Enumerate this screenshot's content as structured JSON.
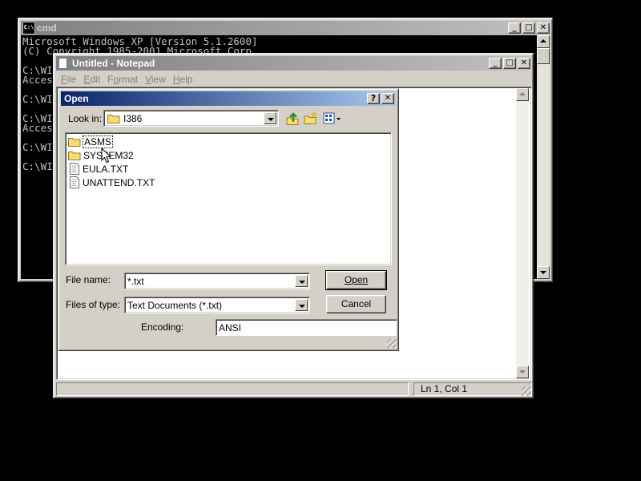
{
  "cmd": {
    "title": "cmd",
    "lines": [
      "Microsoft Windows XP [Version 5.1.2600]",
      "(C) Copyright 1985-2001 Microsoft Corp.",
      "",
      "C:\\WI",
      "Acces",
      "",
      "C:\\WI",
      "",
      "C:\\WI",
      "Acces",
      "",
      "C:\\WI",
      "",
      "C:\\WI"
    ]
  },
  "notepad": {
    "title": "Untitled - Notepad",
    "menu": [
      {
        "label": "File",
        "key": "F"
      },
      {
        "label": "Edit",
        "key": "E"
      },
      {
        "label": "Format",
        "key": "o"
      },
      {
        "label": "View",
        "key": "V"
      },
      {
        "label": "Help",
        "key": "H"
      }
    ],
    "status": "Ln 1, Col 1"
  },
  "open_dialog": {
    "title": "Open",
    "help_btn": "?",
    "look_in_label": "Look in:",
    "look_in_value": "I386",
    "items": [
      {
        "name": "ASMS",
        "type": "folder"
      },
      {
        "name": "SYSTEM32",
        "type": "folder"
      },
      {
        "name": "EULA.TXT",
        "type": "file"
      },
      {
        "name": "UNATTEND.TXT",
        "type": "file"
      }
    ],
    "file_name_label": "File name:",
    "file_name_value": "*.txt",
    "files_of_type_label": "Files of type:",
    "files_of_type_value": "Text Documents (*.txt)",
    "encoding_label": "Encoding:",
    "encoding_value": "ANSI",
    "open_button": "Open",
    "cancel_button": "Cancel"
  },
  "colors": {
    "active_title": "#0a246a",
    "inactive_title": "#808080",
    "window_face": "#d4d0c8"
  }
}
